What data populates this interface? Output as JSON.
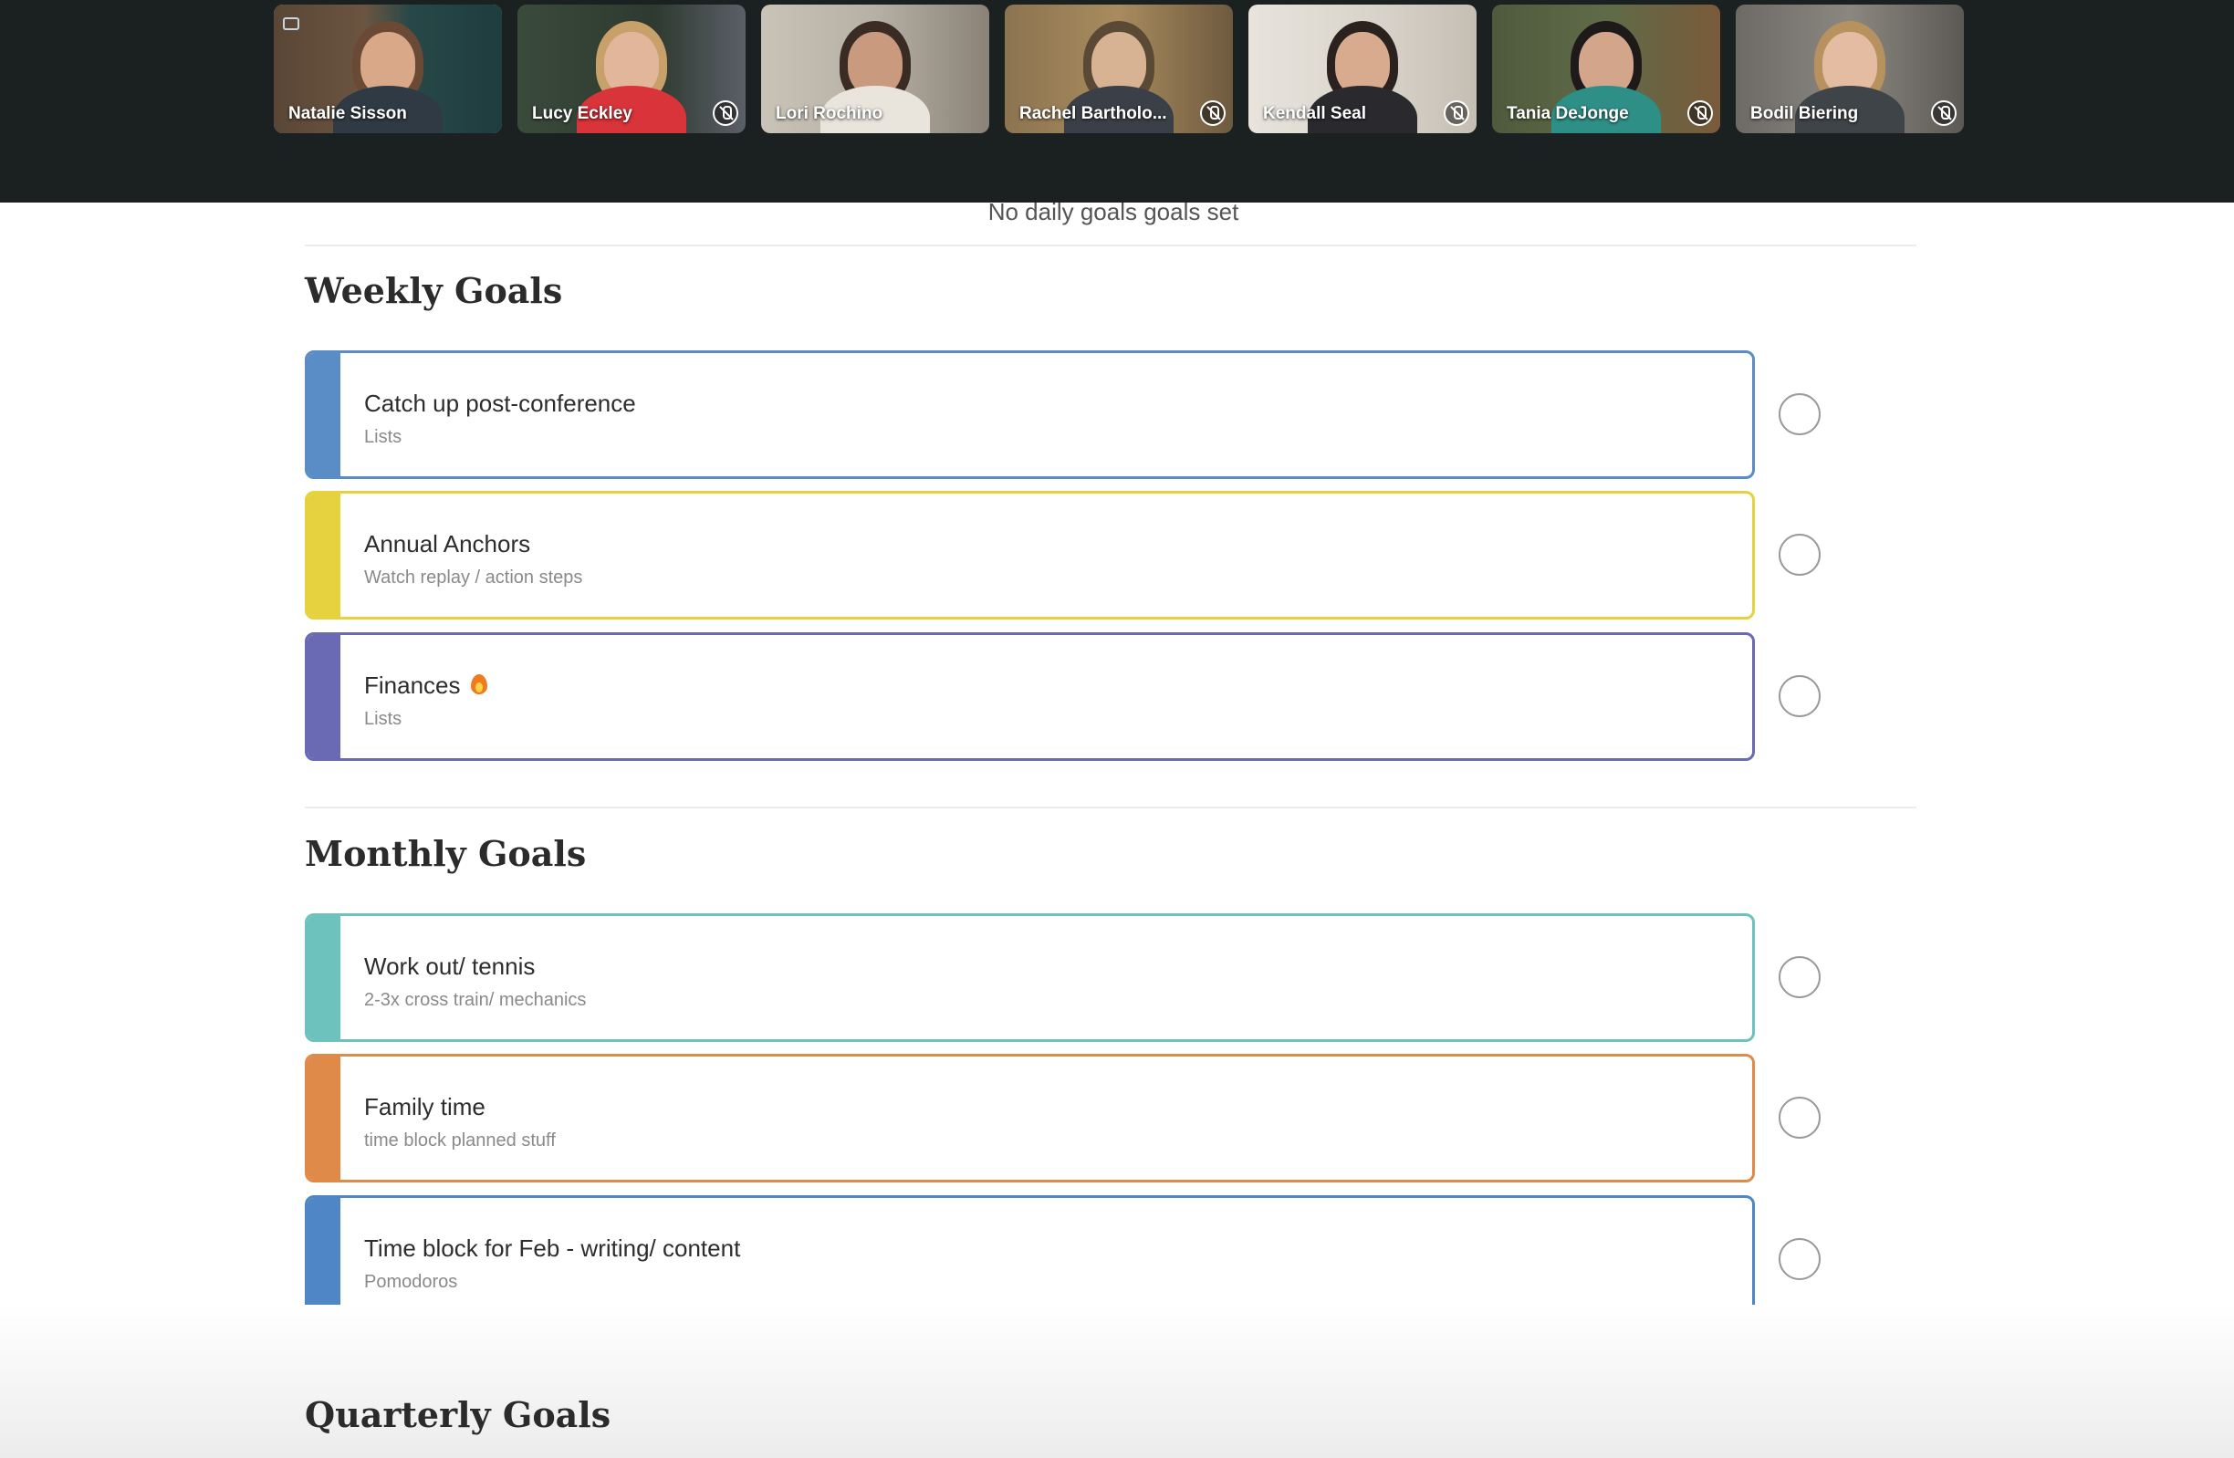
{
  "call": {
    "participants": [
      {
        "name": "Natalie Sisson",
        "muted": false
      },
      {
        "name": "Lucy Eckley",
        "muted": true
      },
      {
        "name": "Lori Rochino",
        "muted": false
      },
      {
        "name": "Rachel Bartholo...",
        "muted": true
      },
      {
        "name": "Kendall Seal",
        "muted": true
      },
      {
        "name": "Tania DeJonge",
        "muted": true
      },
      {
        "name": "Bodil Biering",
        "muted": true
      }
    ]
  },
  "daily": {
    "empty_text": "No daily goals goals set"
  },
  "weekly": {
    "title": "Weekly Goals",
    "goals": [
      {
        "title": "Catch up post-conference",
        "subtitle": "Lists",
        "color": "#5a8cc6"
      },
      {
        "title": "Annual Anchors",
        "subtitle": "Watch replay / action steps",
        "color": "#e6d23e"
      },
      {
        "title": "Finances",
        "subtitle": "Lists",
        "color": "#6a69b4"
      }
    ]
  },
  "monthly": {
    "title": "Monthly Goals",
    "goals": [
      {
        "title": "Work out/ tennis",
        "subtitle": "2-3x cross train/ mechanics",
        "color": "#6dc2be"
      },
      {
        "title": "Family time",
        "subtitle": "time block planned stuff",
        "color": "#e08a4a"
      },
      {
        "title": "Time block for Feb - writing/ content",
        "subtitle": "Pomodoros",
        "color": "#4f86c6"
      }
    ]
  },
  "quarterly": {
    "title": "Quarterly Goals"
  }
}
